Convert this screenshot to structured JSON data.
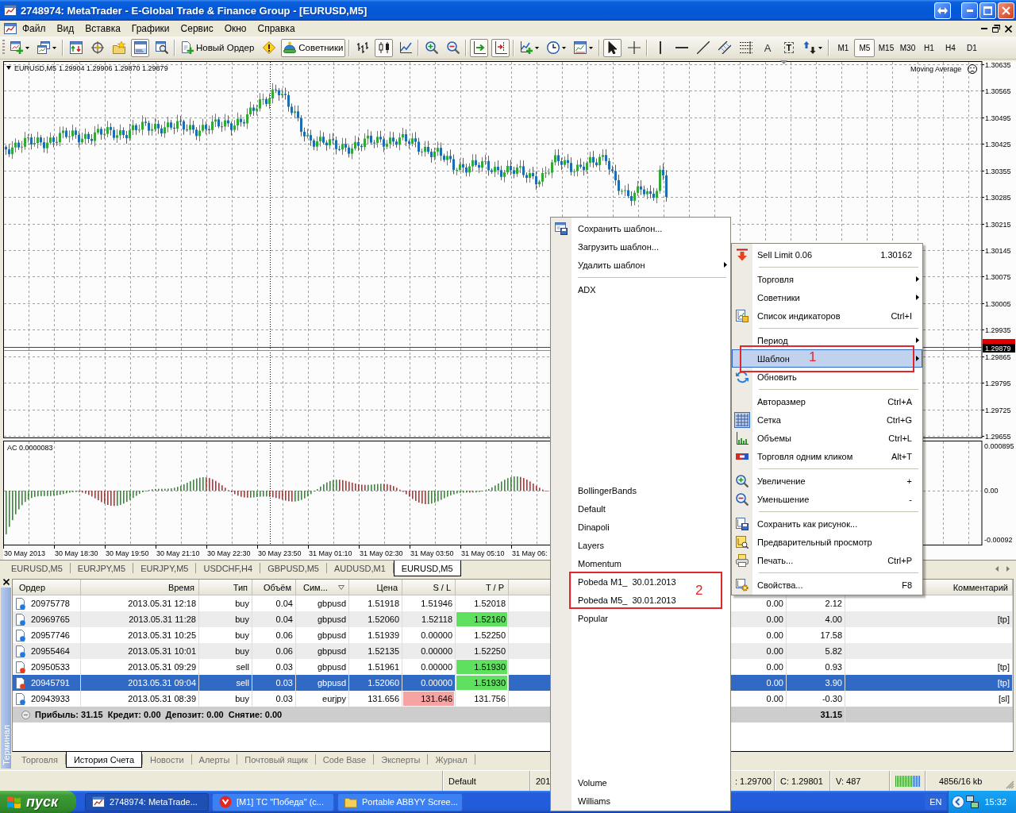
{
  "window": {
    "title": "2748974: MetaTrader - E-Global Trade & Finance Group - [EURUSD,M5]"
  },
  "menu_bar": [
    "Файл",
    "Вид",
    "Вставка",
    "Графики",
    "Сервис",
    "Окно",
    "Справка"
  ],
  "toolbar": {
    "groups": [
      [
        {
          "kind": "icon",
          "pressed": false
        },
        {
          "kind": "icon",
          "pressed": false
        }
      ],
      [
        {
          "kind": "icon",
          "pressed": false
        },
        {
          "kind": "icon",
          "pressed": false
        },
        {
          "kind": "icon",
          "pressed": false
        },
        {
          "kind": "icon",
          "pressed": true
        },
        {
          "kind": "icon",
          "pressed": false
        }
      ],
      [
        {
          "kind": "text",
          "label": "Новый Ордер",
          "pressed": false
        },
        {
          "kind": "icon",
          "pressed": false
        },
        {
          "kind": "text",
          "label": "Советники",
          "pressed": true
        }
      ],
      [
        {
          "kind": "icon",
          "pressed": false
        },
        {
          "kind": "icon",
          "pressed": true
        },
        {
          "kind": "icon",
          "pressed": false
        }
      ],
      [
        {
          "kind": "icon",
          "pressed": false
        },
        {
          "kind": "icon",
          "pressed": false
        }
      ],
      [
        {
          "kind": "icon",
          "pressed": true
        },
        {
          "kind": "icon",
          "pressed": true
        }
      ],
      [
        {
          "kind": "icon",
          "pressed": false
        },
        {
          "kind": "icon",
          "pressed": false
        },
        {
          "kind": "icon",
          "pressed": false
        }
      ],
      [
        {
          "kind": "icon",
          "pressed": true
        },
        {
          "kind": "icon",
          "pressed": false
        }
      ],
      [
        {
          "kind": "icon",
          "pressed": false
        },
        {
          "kind": "icon",
          "pressed": false
        },
        {
          "kind": "icon",
          "pressed": false
        },
        {
          "kind": "icon",
          "pressed": false
        },
        {
          "kind": "icon",
          "pressed": false
        },
        {
          "kind": "glyph",
          "label": "A",
          "pressed": false
        },
        {
          "kind": "boxed_glyph",
          "label": "T",
          "pressed": false
        },
        {
          "kind": "icon",
          "pressed": false
        }
      ]
    ],
    "timeframes": [
      {
        "label": "M1",
        "selected": false
      },
      {
        "label": "M5",
        "selected": true
      },
      {
        "label": "M15",
        "selected": false
      },
      {
        "label": "M30",
        "selected": false
      },
      {
        "label": "H1",
        "selected": false
      },
      {
        "label": "H4",
        "selected": false
      },
      {
        "label": "D1",
        "selected": false
      }
    ]
  },
  "chart": {
    "symbol": "EURUSD,M5",
    "ohlc": "1.29904 1.29906 1.29870 1.29879",
    "indicator": "Moving Average",
    "price_ticks": [
      "1.30635",
      "1.30565",
      "1.30495",
      "1.30425",
      "1.30355",
      "1.30285",
      "1.30215",
      "1.30145",
      "1.30075",
      "1.30005",
      "1.29935",
      "1.29865",
      "1.29795",
      "1.29725",
      "1.29655"
    ],
    "current_price": "1.29879",
    "oscillator": {
      "label": "AC 0.0000083",
      "ticks": [
        "0.000895",
        "0.00",
        "-0.00092"
      ]
    },
    "time_ticks": [
      "30 May 2013",
      "30 May 18:30",
      "30 May 19:50",
      "30 May 21:10",
      "30 May 22:30",
      "30 May 23:50",
      "31 May 01:10",
      "31 May 02:30",
      "31 May 03:50",
      "31 May 05:10",
      "31 May 06:"
    ]
  },
  "chart_tabs": [
    {
      "label": "EURUSD,M5",
      "selected": false
    },
    {
      "label": "EURJPY,M5",
      "selected": false
    },
    {
      "label": "EURJPY,M5",
      "selected": false
    },
    {
      "label": "USDCHF,H4",
      "selected": false
    },
    {
      "label": "GBPUSD,M5",
      "selected": false
    },
    {
      "label": "AUDUSD,M1",
      "selected": false
    },
    {
      "label": "EURUSD,M5",
      "selected": true
    }
  ],
  "terminal": {
    "title": "Терминал",
    "columns": [
      {
        "label": "Ордер",
        "sorted": false
      },
      {
        "label": "Время",
        "sorted": false
      },
      {
        "label": "Тип",
        "sorted": false
      },
      {
        "label": "Объём",
        "sorted": false
      },
      {
        "label": "Сим...",
        "sorted": true
      },
      {
        "label": "Цена",
        "sorted": false
      },
      {
        "label": "S / L",
        "sorted": false
      },
      {
        "label": "T / P",
        "sorted": false
      },
      {
        "label": "Комментарий",
        "sorted": false
      }
    ],
    "rows": [
      {
        "kind": "buy",
        "selected": false,
        "tp_hit": false,
        "sl_hit": false,
        "order": "20975778",
        "time": "2013.05.31 12:18",
        "type": "buy",
        "volume": "0.04",
        "symbol": "gbpusd",
        "price": "1.51918",
        "sl": "1.51946",
        "tp": "1.52018",
        "column_9": "0.00",
        "column_10": "2.12"
      },
      {
        "kind": "buy",
        "selected": false,
        "tp_hit": true,
        "sl_hit": false,
        "order": "20969765",
        "time": "2013.05.31 11:28",
        "type": "buy",
        "volume": "0.04",
        "symbol": "gbpusd",
        "price": "1.52060",
        "sl": "1.52118",
        "tp": "1.52160",
        "column_9": "0.00",
        "column_10": "4.00",
        "comment": "[tp]"
      },
      {
        "kind": "buy",
        "selected": false,
        "tp_hit": false,
        "sl_hit": false,
        "order": "20957746",
        "time": "2013.05.31 10:25",
        "type": "buy",
        "volume": "0.06",
        "symbol": "gbpusd",
        "price": "1.51939",
        "sl": "0.00000",
        "tp": "1.52250",
        "column_9": "0.00",
        "column_10": "17.58"
      },
      {
        "kind": "buy",
        "selected": false,
        "tp_hit": false,
        "sl_hit": false,
        "order": "20955464",
        "time": "2013.05.31 10:01",
        "type": "buy",
        "volume": "0.06",
        "symbol": "gbpusd",
        "price": "1.52135",
        "sl": "0.00000",
        "tp": "1.52250",
        "column_9": "0.00",
        "column_10": "5.82"
      },
      {
        "kind": "sell",
        "selected": false,
        "tp_hit": true,
        "sl_hit": false,
        "order": "20950533",
        "time": "2013.05.31 09:29",
        "type": "sell",
        "volume": "0.03",
        "symbol": "gbpusd",
        "price": "1.51961",
        "sl": "0.00000",
        "tp": "1.51930",
        "column_9": "0.00",
        "column_10": "0.93",
        "comment": "[tp]"
      },
      {
        "kind": "sell",
        "selected": true,
        "tp_hit": true,
        "sl_hit": false,
        "order": "20945791",
        "time": "2013.05.31 09:04",
        "type": "sell",
        "volume": "0.03",
        "symbol": "gbpusd",
        "price": "1.52060",
        "sl": "0.00000",
        "tp": "1.51930",
        "column_9": "0.00",
        "column_10": "3.90",
        "comment": "[tp]"
      },
      {
        "kind": "buy",
        "selected": false,
        "tp_hit": false,
        "sl_hit": true,
        "order": "20943933",
        "time": "2013.05.31 08:39",
        "type": "buy",
        "volume": "0.03",
        "symbol": "eurjpy",
        "price": "131.656",
        "sl": "131.646",
        "tp": "131.756",
        "column_9": "0.00",
        "column_10": "-0.30",
        "comment": "[sl]"
      }
    ],
    "summary": {
      "text": "Прибыль: 31.15  Кредит: 0.00  Депозит: 0.00  Снятие: 0.00",
      "total": "31.15"
    },
    "tabs": [
      {
        "label": "Торговля",
        "selected": false
      },
      {
        "label": "История Счета",
        "selected": true
      },
      {
        "label": "Новости",
        "selected": false
      },
      {
        "label": "Алерты",
        "selected": false
      },
      {
        "label": "Почтовый ящик",
        "selected": false
      },
      {
        "label": "Code Base",
        "selected": false
      },
      {
        "label": "Эксперты",
        "selected": false
      },
      {
        "label": "Журнал",
        "selected": false
      }
    ]
  },
  "status_bar": [
    "Default",
    "201",
    ": 1.29700",
    "C: 1.29801",
    "V: 487",
    "4856/16 kb"
  ],
  "taskbar": {
    "start": "пуск",
    "tasks": [
      {
        "label": "2748974: MetaTrade...",
        "selected": true
      },
      {
        "label": "[M1] ТС \"Победа\" (с...",
        "selected": false
      },
      {
        "label": "Portable ABBYY Scree...",
        "selected": false
      }
    ],
    "language": "EN",
    "clock": "15:32"
  },
  "template_menu": {
    "items": [
      {
        "kind": "item",
        "label": "Сохранить шаблон...",
        "submenu": false
      },
      {
        "kind": "item",
        "label": "Загрузить шаблон...",
        "submenu": false
      },
      {
        "kind": "item",
        "label": "Удалить шаблон",
        "submenu": true
      },
      {
        "kind": "separator"
      },
      {
        "kind": "item",
        "label": "ADX",
        "submenu": false
      },
      {
        "kind": "blank"
      },
      {
        "kind": "blank"
      },
      {
        "kind": "blank"
      },
      {
        "kind": "blank"
      },
      {
        "kind": "blank"
      },
      {
        "kind": "blank"
      },
      {
        "kind": "blank"
      },
      {
        "kind": "blank"
      },
      {
        "kind": "blank"
      },
      {
        "kind": "blank"
      },
      {
        "kind": "item",
        "label": "BollingerBands",
        "submenu": false
      },
      {
        "kind": "item",
        "label": "Default",
        "submenu": false
      },
      {
        "kind": "item",
        "label": "Dinapoli",
        "submenu": false
      },
      {
        "kind": "item",
        "label": "Layers",
        "submenu": false
      },
      {
        "kind": "item",
        "label": "Momentum",
        "submenu": false
      },
      {
        "kind": "item",
        "label": "Pobeda M1_  30.01.2013",
        "submenu": false
      },
      {
        "kind": "item",
        "label": "Pobeda M5_  30.01.2013",
        "submenu": false
      },
      {
        "kind": "item",
        "label": "Popular",
        "submenu": false
      },
      {
        "kind": "blank"
      },
      {
        "kind": "blank"
      },
      {
        "kind": "blank"
      },
      {
        "kind": "blank"
      },
      {
        "kind": "blank"
      },
      {
        "kind": "blank"
      },
      {
        "kind": "blank"
      },
      {
        "kind": "blank"
      },
      {
        "kind": "item",
        "label": "Volume",
        "submenu": false
      },
      {
        "kind": "item",
        "label": "Williams",
        "submenu": false
      }
    ]
  },
  "context_menu": {
    "items": [
      {
        "kind": "item",
        "label": "Sell Limit 0.06",
        "price": "1.30162",
        "submenu": false,
        "checked": false,
        "highlighted": false
      },
      {
        "kind": "separator"
      },
      {
        "kind": "item",
        "label": "Торговля",
        "submenu": true,
        "checked": false,
        "highlighted": false
      },
      {
        "kind": "item",
        "label": "Советники",
        "submenu": true,
        "checked": false,
        "highlighted": false
      },
      {
        "kind": "item",
        "label": "Список индикаторов",
        "shortcut": "Ctrl+I",
        "submenu": false,
        "checked": false,
        "highlighted": false
      },
      {
        "kind": "separator"
      },
      {
        "kind": "item",
        "label": "Период",
        "submenu": true,
        "checked": false,
        "highlighted": false
      },
      {
        "kind": "item",
        "label": "Шаблон",
        "submenu": true,
        "checked": false,
        "highlighted": true
      },
      {
        "kind": "item",
        "label": "Обновить",
        "submenu": false,
        "checked": false,
        "highlighted": false
      },
      {
        "kind": "separator"
      },
      {
        "kind": "item",
        "label": "Авторазмер",
        "shortcut": "Ctrl+A",
        "submenu": false,
        "checked": false,
        "highlighted": false
      },
      {
        "kind": "item",
        "label": "Сетка",
        "shortcut": "Ctrl+G",
        "submenu": false,
        "checked": true,
        "highlighted": false
      },
      {
        "kind": "item",
        "label": "Объемы",
        "shortcut": "Ctrl+L",
        "submenu": false,
        "checked": false,
        "highlighted": false
      },
      {
        "kind": "item",
        "label": "Торговля одним кликом",
        "shortcut": "Alt+T",
        "submenu": false,
        "checked": false,
        "highlighted": false
      },
      {
        "kind": "separator"
      },
      {
        "kind": "item",
        "label": "Увеличение",
        "shortcut": "+",
        "submenu": false,
        "checked": false,
        "highlighted": false
      },
      {
        "kind": "item",
        "label": "Уменьшение",
        "shortcut": "-",
        "submenu": false,
        "checked": false,
        "highlighted": false
      },
      {
        "kind": "separator"
      },
      {
        "kind": "item",
        "label": "Сохранить как рисунок...",
        "submenu": false,
        "checked": false,
        "highlighted": false
      },
      {
        "kind": "item",
        "label": "Предварительный просмотр",
        "submenu": false,
        "checked": false,
        "highlighted": false
      },
      {
        "kind": "item",
        "label": "Печать...",
        "shortcut": "Ctrl+P",
        "submenu": false,
        "checked": false,
        "highlighted": false
      },
      {
        "kind": "separator"
      },
      {
        "kind": "item",
        "label": "Свойства...",
        "shortcut": "F8",
        "submenu": false,
        "checked": false,
        "highlighted": false
      }
    ]
  },
  "annotations": [
    {
      "label": "1"
    },
    {
      "label": "2"
    }
  ]
}
